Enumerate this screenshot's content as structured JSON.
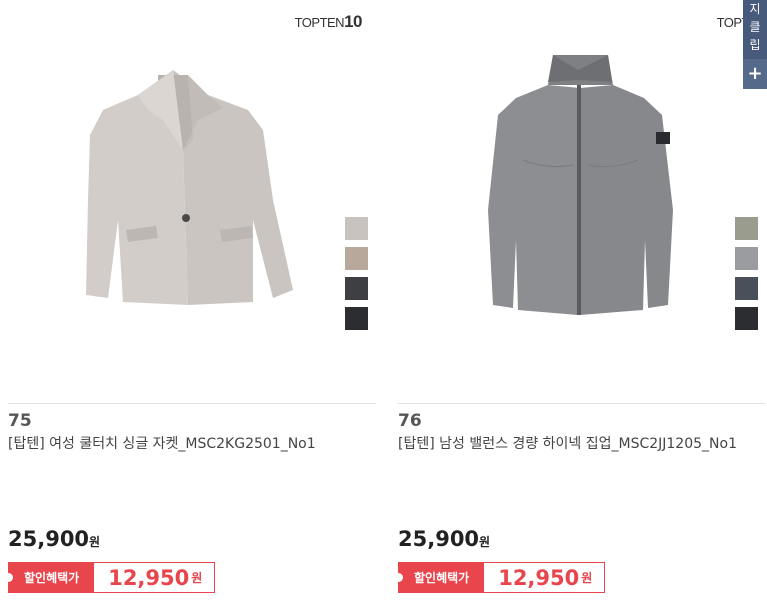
{
  "products": [
    {
      "brand_logo": "TOPTEN10",
      "rank": "75",
      "name": "[탑텐] 여성 쿨터치 싱글 자켓_MSC2KG2501_No1",
      "price": "25,900",
      "price_unit": "원",
      "discount_label": "할인혜택가",
      "sale_price": "12,950",
      "sale_unit": "원",
      "swatches": [
        "#c8c3bf",
        "#b8a89b",
        "#3d3f42",
        "#2b2d31"
      ]
    },
    {
      "brand_logo": "TOPTEN10",
      "rank": "76",
      "name": "[탑텐] 남성 밸런스 경량 하이넥 집업_MSC2JJ1205_No1",
      "price": "25,900",
      "price_unit": "원",
      "discount_label": "할인혜택가",
      "sale_price": "12,950",
      "sale_unit": "원",
      "swatches": [
        "#9a9c8e",
        "#9a9c9f",
        "#4a5059",
        "#2b2d31"
      ]
    }
  ],
  "side_panel": {
    "text": "지\n클\n립",
    "plus": "+"
  }
}
